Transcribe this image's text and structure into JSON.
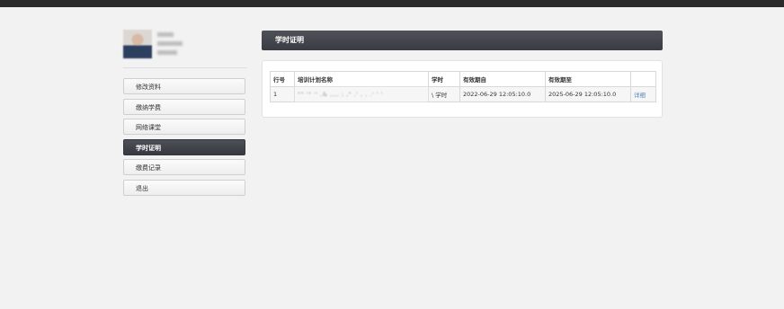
{
  "profile": {
    "name": "",
    "lines": [
      "",
      ""
    ]
  },
  "sidebar": {
    "items": [
      {
        "label": "修改资料",
        "active": false
      },
      {
        "label": "缴纳学费",
        "active": false
      },
      {
        "label": "网络课堂",
        "active": false
      },
      {
        "label": "学时证明",
        "active": true
      },
      {
        "label": "缴费记录",
        "active": false
      },
      {
        "label": "退出",
        "active": false
      }
    ]
  },
  "main": {
    "title": "学时证明",
    "table": {
      "headers": [
        "行号",
        "培训计划名称",
        "学时",
        "有效期自",
        "有效期至",
        ""
      ],
      "rows": [
        {
          "index": "1",
          "plan_name": "\"\" '° '' ,&  ,,,, ; ,\"  .' , , .' ' '",
          "hours": "\\ 学时",
          "valid_from": "2022-06-29 12:05:10.0",
          "valid_to": "2025-06-29 12:05:10.0",
          "action": "详细"
        }
      ]
    }
  },
  "colors": {
    "topbar": "#2b2b2b",
    "active_menu": "#3f4248",
    "header_bar": "#44474d",
    "link": "#5b87b6",
    "page_background": "#f2f2f2"
  }
}
